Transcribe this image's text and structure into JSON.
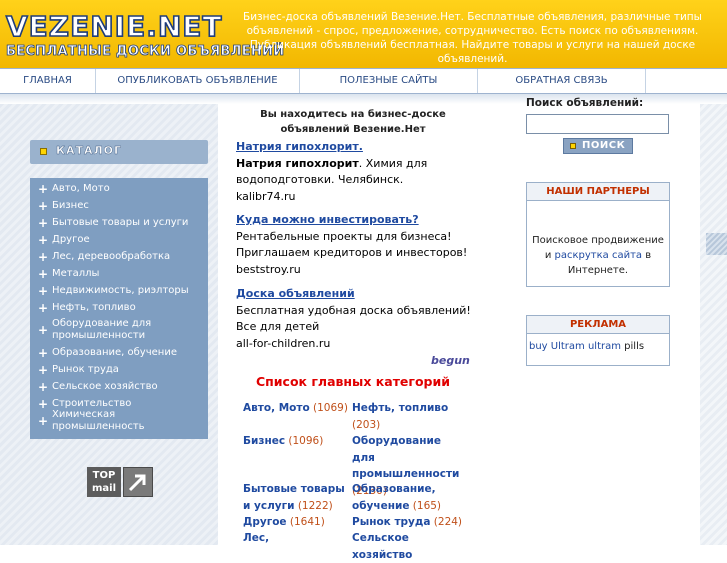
{
  "header": {
    "logo": "VEZENIE.NET",
    "tagline": "БЕСПЛАТНЫЕ ДОСКИ ОБЪЯВЛЕНИЙ",
    "description": "Бизнес-доска объявлений Везение.Нет. Бесплатные объявления, различные типы объявлений - спрос, предложение, сотрудничество. Есть поиск по объявлениям. Публикация объявлений бесплатная. Найдите товары и услуги на нашей доске объявлений."
  },
  "nav": {
    "items": [
      {
        "label": "ГЛАВНАЯ"
      },
      {
        "label": "ОПУБЛИКОВАТЬ ОБЪЯВЛЕНИЕ"
      },
      {
        "label": "ПОЛЕЗНЫЕ САЙТЫ"
      },
      {
        "label": "ОБРАТНАЯ СВЯЗЬ"
      }
    ]
  },
  "sidebar": {
    "catalog_title": "КАТАЛОГ",
    "items": [
      {
        "label": "Авто, Мото"
      },
      {
        "label": "Бизнес"
      },
      {
        "label": "Бытовые товары и услуги"
      },
      {
        "label": "Другое"
      },
      {
        "label": "Лес, деревообработка"
      },
      {
        "label": "Металлы"
      },
      {
        "label": "Недвижимость, риэлторы"
      },
      {
        "label": "Нефть, топливо"
      },
      {
        "label": "Оборудование для промышленности"
      },
      {
        "label": "Образование, обучение"
      },
      {
        "label": "Рынок труда"
      },
      {
        "label": "Сельское хозяйство"
      },
      {
        "label": "Строительство"
      },
      {
        "label": "Химическая промышленность"
      }
    ],
    "counter": {
      "line1": "TOP",
      "line2": "mail"
    }
  },
  "main": {
    "location": "Вы находитесь на бизнес-доске объявлений Везение.Нет",
    "ads": [
      {
        "title": "Натрия гипохлорит.",
        "bold": "Натрия гипохлорит",
        "text": ". Химия для водоподготовки. Челябинск.",
        "domain": "kalibr74.ru"
      },
      {
        "title": "Куда можно инвестировать?",
        "bold": "",
        "text": "Рентабельные проекты для бизнеса! Приглашаем кредиторов и инвесторов!",
        "domain": "beststroy.ru"
      },
      {
        "title": "Доска объявлений",
        "bold": "",
        "text": "Бесплатная удобная доска объявлений! Все для детей",
        "domain": "all-for-children.ru"
      }
    ],
    "begun": "begun",
    "categories_title": "Список главных категорий",
    "categories": [
      {
        "name": "Авто, Мото",
        "count": "(1069)"
      },
      {
        "name": "Нефть, топливо",
        "count": "(203)"
      },
      {
        "name": "Бизнес",
        "count": "(1096)"
      },
      {
        "name": "Оборудование для промышленности",
        "count": "(2130)"
      },
      {
        "name": "Бытовые товары и услуги",
        "count": "(1222)"
      },
      {
        "name": "Образование, обучение",
        "count": "(165)"
      },
      {
        "name": "Другое",
        "count": "(1641)"
      },
      {
        "name": "Рынок труда",
        "count": "(224)"
      },
      {
        "name": "Лес,",
        "count": ""
      },
      {
        "name": "Сельское хозяйство",
        "count": ""
      }
    ]
  },
  "right": {
    "search_label": "Поиск объявлений:",
    "search_value": "",
    "search_button": "ПОИСК",
    "partners_title": "НАШИ ПАРТНЕРЫ",
    "partners_text_1": "Поисковое продвижение и ",
    "partners_link": "раскрутка сайта",
    "partners_text_2": " в Интернете.",
    "ads_title": "РЕКЛАМА",
    "ads_link": "buy Ultram ultram",
    "ads_text": " pills"
  },
  "colors": {
    "header_yellow": "#f2b700",
    "nav_text": "#2a4b84",
    "sidebar_blue": "#7f9ec1",
    "link_blue": "#1f4aa0",
    "count_orange": "#c0501a",
    "title_red": "#e00000"
  }
}
